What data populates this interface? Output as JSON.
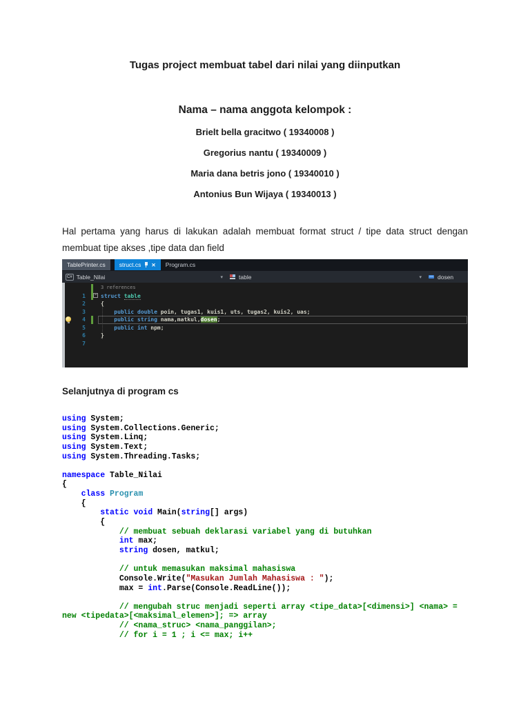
{
  "document": {
    "title": "Tugas project membuat tabel dari nilai yang diinputkan",
    "group_heading": "Nama – nama anggota kelompok :",
    "members": [
      "Brielt bella gracitwo ( 19340008 )",
      "Gregorius nantu ( 19340009 )",
      "Maria dana betris jono ( 19340010 )",
      "Antonius Bun Wijaya ( 19340013 )"
    ],
    "intro_paragraph": "Hal pertama yang harus di lakukan adalah membuat format struct / tipe data struct dengan membuat tipe akses ,tipe data dan field",
    "section2_heading": "Selanjutnya di program cs"
  },
  "vs": {
    "tabs": [
      {
        "label": "TablePrinter.cs"
      },
      {
        "label": "struct.cs"
      },
      {
        "label": "Program.cs"
      }
    ],
    "close_glyph": "✕",
    "fold_glyph": "−",
    "navbar": {
      "project_badge": "C#",
      "project": "Table_Nilai",
      "type_label": "table",
      "member_label": "dosen",
      "dropdown_glyph": "▾"
    },
    "colors": {
      "active_tab_blue": "#0e83d8",
      "inactive_tab_gray": "#49525f",
      "editor_background": "#1c1c1c",
      "keyword_blue": "#569cd6",
      "type_teal": "#4ec9b0",
      "selection_green": "#4e7c30",
      "change_bar_green": "#5f9e3c"
    },
    "editor": {
      "lines": [
        {
          "lens": "3 references",
          "changed": true
        },
        {
          "n": "1",
          "fold": true,
          "changed": true,
          "tokens": [
            {
              "c": "k",
              "t": "struct"
            },
            {
              "c": "id",
              "t": " "
            },
            {
              "c": "tyU",
              "t": "table"
            }
          ]
        },
        {
          "n": "2",
          "tokens": [
            {
              "c": "id",
              "t": "{"
            }
          ]
        },
        {
          "n": "3",
          "tokens": [
            {
              "c": "id",
              "t": "    "
            },
            {
              "c": "k",
              "t": "public"
            },
            {
              "c": "id",
              "t": " "
            },
            {
              "c": "k",
              "t": "double"
            },
            {
              "c": "id",
              "t": " poin, tugas1, kuis1, uts, tugas2, kuis2, uas;"
            }
          ]
        },
        {
          "n": "4",
          "bulb": true,
          "changed": true,
          "current": true,
          "tokens": [
            {
              "c": "id",
              "t": "    "
            },
            {
              "c": "k",
              "t": "public"
            },
            {
              "c": "id",
              "t": " "
            },
            {
              "c": "k",
              "t": "string"
            },
            {
              "c": "id",
              "t": " nama,matkul,"
            },
            {
              "c": "sel",
              "t": "dosen"
            },
            {
              "c": "id",
              "t": ";"
            }
          ]
        },
        {
          "n": "5",
          "tokens": [
            {
              "c": "id",
              "t": "    "
            },
            {
              "c": "k",
              "t": "public"
            },
            {
              "c": "id",
              "t": " "
            },
            {
              "c": "k",
              "t": "int"
            },
            {
              "c": "id",
              "t": " npm;"
            }
          ]
        },
        {
          "n": "6",
          "tokens": [
            {
              "c": "id",
              "t": "}"
            }
          ]
        },
        {
          "n": "7",
          "tokens": []
        }
      ]
    }
  },
  "program_code": {
    "lines": [
      [
        {
          "c": "lk",
          "t": "using"
        },
        {
          "c": "lp",
          "t": " System;"
        }
      ],
      [
        {
          "c": "lk",
          "t": "using"
        },
        {
          "c": "lp",
          "t": " System.Collections.Generic;"
        }
      ],
      [
        {
          "c": "lk",
          "t": "using"
        },
        {
          "c": "lp",
          "t": " System.Linq;"
        }
      ],
      [
        {
          "c": "lk",
          "t": "using"
        },
        {
          "c": "lp",
          "t": " System.Text;"
        }
      ],
      [
        {
          "c": "lk",
          "t": "using"
        },
        {
          "c": "lp",
          "t": " System.Threading.Tasks;"
        }
      ],
      [],
      [
        {
          "c": "lk",
          "t": "namespace"
        },
        {
          "c": "lp",
          "t": " Table_Nilai"
        }
      ],
      [
        {
          "c": "lp",
          "t": "{"
        }
      ],
      [
        {
          "c": "lp",
          "t": "    "
        },
        {
          "c": "lk",
          "t": "class"
        },
        {
          "c": "lp",
          "t": " "
        },
        {
          "c": "lty",
          "t": "Program"
        }
      ],
      [
        {
          "c": "lp",
          "t": "    {"
        }
      ],
      [
        {
          "c": "lp",
          "t": "        "
        },
        {
          "c": "lk",
          "t": "static"
        },
        {
          "c": "lp",
          "t": " "
        },
        {
          "c": "lk",
          "t": "void"
        },
        {
          "c": "lp",
          "t": " Main("
        },
        {
          "c": "lk",
          "t": "string"
        },
        {
          "c": "lp",
          "t": "[] args)"
        }
      ],
      [
        {
          "c": "lp",
          "t": "        {"
        }
      ],
      [
        {
          "c": "lc",
          "t": "            // membuat sebuah deklarasi variabel yang di butuhkan"
        }
      ],
      [
        {
          "c": "lp",
          "t": "            "
        },
        {
          "c": "lk",
          "t": "int"
        },
        {
          "c": "lp",
          "t": " max;"
        }
      ],
      [
        {
          "c": "lp",
          "t": "            "
        },
        {
          "c": "lk",
          "t": "string"
        },
        {
          "c": "lp",
          "t": " dosen, matkul;"
        }
      ],
      [],
      [
        {
          "c": "lc",
          "t": "            // untuk memasukan maksimal mahasiswa"
        }
      ],
      [
        {
          "c": "lp",
          "t": "            Console.Write("
        },
        {
          "c": "ls",
          "t": "\"Masukan Jumlah Mahasiswa : \""
        },
        {
          "c": "lp",
          "t": ");"
        }
      ],
      [
        {
          "c": "lp",
          "t": "            max = "
        },
        {
          "c": "lk",
          "t": "int"
        },
        {
          "c": "lp",
          "t": ".Parse(Console.ReadLine());"
        }
      ],
      [],
      [
        {
          "c": "lc",
          "t": "            // mengubah struc menjadi seperti array <tipe_data>[<dimensi>] <nama> ="
        }
      ],
      [
        {
          "c": "lc",
          "t": "new <tipedata>[<maksimal_elemen>]; => array"
        }
      ],
      [
        {
          "c": "lc",
          "t": "            // <nama_struc> <nama_panggilan>;"
        }
      ],
      [
        {
          "c": "lc",
          "t": "            // for i = 1 ; i <= max; i++"
        }
      ]
    ]
  }
}
